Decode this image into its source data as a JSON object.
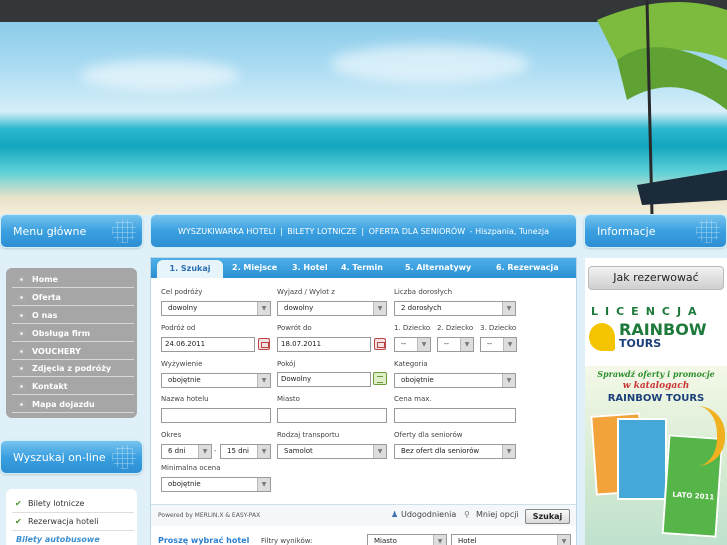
{
  "nav": {
    "items": [
      "WYSZUKIWARKA HOTELI",
      "BILETY LOTNICZE",
      "OFERTA DLA SENIORÓW"
    ],
    "separator": "|",
    "suffix": "- Hiszpania, Tunezja"
  },
  "left": {
    "menu_title": "Menu główne",
    "menu_items": [
      "Home",
      "Oferta",
      "O nas",
      "Obsługa firm",
      "VOUCHERY",
      "Zdjęcia z podróży",
      "Kontakt",
      "Mapa dojazdu"
    ],
    "search_title": "Wyszukaj on-line",
    "search_items": [
      "Bilety lotnicze",
      "Rezerwacja hoteli",
      "Bilety autobusowe"
    ]
  },
  "right": {
    "title": "Informacje",
    "how_to": "Jak rezerwować",
    "license_word": "LICENCJA",
    "brand_line1": "RAINBOW",
    "brand_line2": "TOURS",
    "promo_line1": "Sprawdź oferty i promocje",
    "promo_line2": "w katalogach",
    "promo_brand": "RAINBOW TOURS",
    "catalog_year": "LATO 2011"
  },
  "tabs": [
    "1. Szukaj",
    "2. Miejsce",
    "3. Hotel",
    "4. Termin",
    "5. Alternatywy",
    "6. Rezerwacja"
  ],
  "form": {
    "cel_label": "Cel podróży",
    "cel_value": "dowolny",
    "wyjazd_label": "Wyjazd / Wylot z",
    "wyjazd_value": "dowolny",
    "dorosli_label": "Liczba dorosłych",
    "dorosli_value": "2 dorosłych",
    "podroz_label": "Podróż od",
    "podroz_value": "24.06.2011",
    "powrot_label": "Powrót do",
    "powrot_value": "18.07.2011",
    "dziecko1_label": "1. Dziecko",
    "dziecko2_label": "2. Dziecko",
    "dziecko3_label": "3. Dziecko",
    "dziecko_value": "--",
    "wyzywienie_label": "Wyżywienie",
    "wyzywienie_value": "obojętnie",
    "pokoj_label": "Pokój",
    "pokoj_value": "Dowolny",
    "kategoria_label": "Kategoria",
    "kategoria_value": "obojętnie",
    "nazwa_label": "Nazwa hotelu",
    "miasto_label": "Miasto",
    "cena_label": "Cena max.",
    "okres_label": "Okres",
    "okres_from": "6 dni",
    "okres_dash": "-",
    "okres_to": "15 dni",
    "transport_label": "Rodzaj transportu",
    "transport_value": "Samolot",
    "senior_label": "Oferty dla seniorów",
    "senior_value": "Bez ofert dla seniorów",
    "ocena_label": "Minimalna ocena",
    "ocena_value": "obojętnie"
  },
  "footer": {
    "powered": "Powered by MERLIN.X & EASY-PAX",
    "udogodnienia": "Udogodnienia",
    "mniej_opcji": "Mniej opcji",
    "szukaj": "Szukaj"
  },
  "results": {
    "prompt": "Proszę wybrać hotel",
    "filters_label": "Filtry wyników:",
    "filter1": "Miasto",
    "filter2": "Hotel"
  },
  "colors": {
    "accent": "#2e8fd3",
    "sidebar": "#a6a6a6",
    "brand_green": "#1e7a3a",
    "brand_blue": "#1b3f7a"
  }
}
